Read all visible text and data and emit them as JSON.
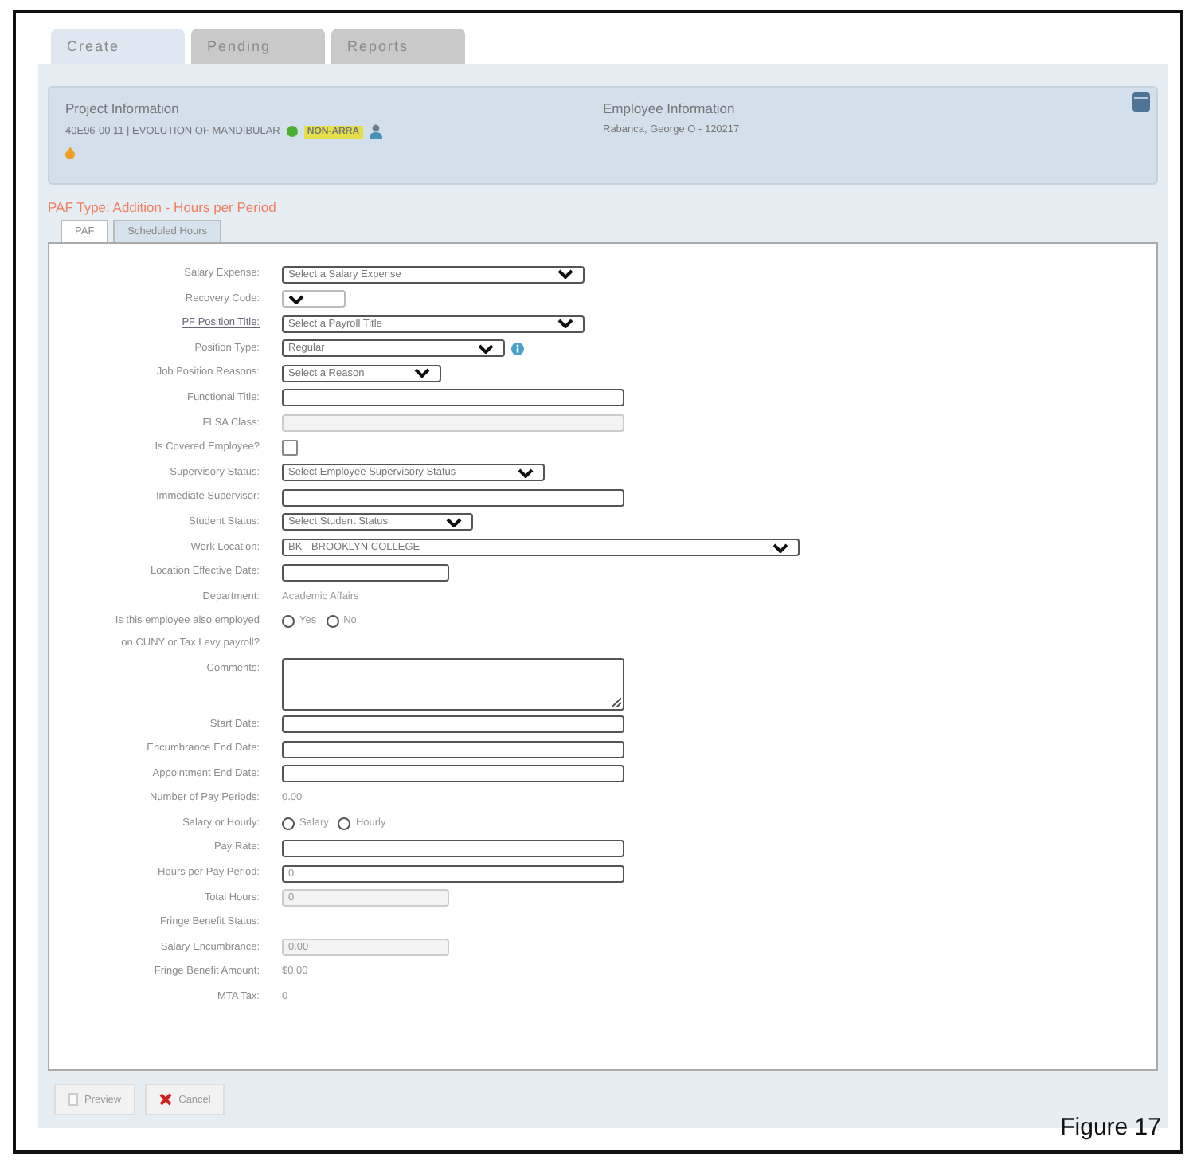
{
  "tabs": [
    {
      "label": "Create",
      "selected": true
    },
    {
      "label": "Pending",
      "selected": false
    },
    {
      "label": "Reports",
      "selected": false
    }
  ],
  "project": {
    "heading": "Project Information",
    "line": "40E96-00 11 | EVOLUTION OF MANDIBULAR",
    "badge": "NON-ARRA"
  },
  "employee": {
    "heading": "Employee Information",
    "line": "Rabanca, George O - 120217"
  },
  "paf_type": "PAF Type: Addition - Hours per Period",
  "sub_tabs": [
    {
      "label": "PAF",
      "selected": true
    },
    {
      "label": "Scheduled Hours",
      "selected": false
    }
  ],
  "fields": [
    {
      "label": "Salary Expense:",
      "kind": "select",
      "value": "Select a Salary Expense"
    },
    {
      "label": "Recovery Code:",
      "kind": "select"
    },
    {
      "label": "PF Position Title:",
      "kind": "select",
      "value": "Select a Payroll Title",
      "link": true
    },
    {
      "label": "Position Type:",
      "kind": "select",
      "value": "Regular",
      "info": true
    },
    {
      "label": "Job Position Reasons:",
      "kind": "select",
      "value": "Select a Reason"
    },
    {
      "label": "Functional Title:",
      "kind": "input"
    },
    {
      "label": "FLSA Class:",
      "kind": "disabled"
    },
    {
      "label": "Is Covered Employee?",
      "kind": "checkbox",
      "checked": false
    },
    {
      "label": "Supervisory Status:",
      "kind": "select",
      "value": "Select Employee Supervisory Status"
    },
    {
      "label": "Immediate Supervisor:",
      "kind": "input"
    },
    {
      "label": "Student Status:",
      "kind": "select",
      "value": "Select Student Status"
    },
    {
      "label": "Work Location:",
      "kind": "select",
      "value": "BK - BROOKLYN COLLEGE"
    },
    {
      "label": "Location Effective Date:",
      "kind": "input"
    },
    {
      "label": "Department:",
      "kind": "static",
      "value": "Academic Affairs"
    },
    {
      "label": "Is this employee also employed on CUNY or Tax Levy payroll?",
      "kind": "radio",
      "options": [
        {
          "label": "Yes",
          "selected": false
        },
        {
          "label": "No",
          "selected": false
        }
      ]
    },
    {
      "label": "Comments:",
      "kind": "textarea"
    },
    {
      "label": "Start Date:",
      "kind": "input"
    },
    {
      "label": "Encumbrance End Date:",
      "kind": "input"
    },
    {
      "label": "Appointment End Date:",
      "kind": "input"
    },
    {
      "label": "Number of Pay Periods:",
      "kind": "static",
      "value": "0.00"
    },
    {
      "label": "Salary or Hourly:",
      "kind": "radio",
      "options": [
        {
          "label": "Salary",
          "selected": false
        },
        {
          "label": "Hourly",
          "selected": false
        }
      ]
    },
    {
      "label": "Pay Rate:",
      "kind": "input"
    },
    {
      "label": "Hours per Pay Period:",
      "kind": "input",
      "value": "0"
    },
    {
      "label": "Total Hours:",
      "kind": "disabled",
      "value": "0"
    },
    {
      "label": "Fringe Benefit Status:",
      "kind": "static"
    },
    {
      "label": "Salary Encumbrance:",
      "kind": "disabled",
      "value": "0.00"
    },
    {
      "label": "Fringe Benefit Amount:",
      "kind": "static",
      "value": "$0.00"
    },
    {
      "label": "MTA Tax:",
      "kind": "static",
      "value": "0"
    }
  ],
  "buttons": [
    {
      "label": "Preview",
      "kind": "preview"
    },
    {
      "label": "Cancel",
      "kind": "cancel"
    }
  ],
  "caption": "Figure 17"
}
